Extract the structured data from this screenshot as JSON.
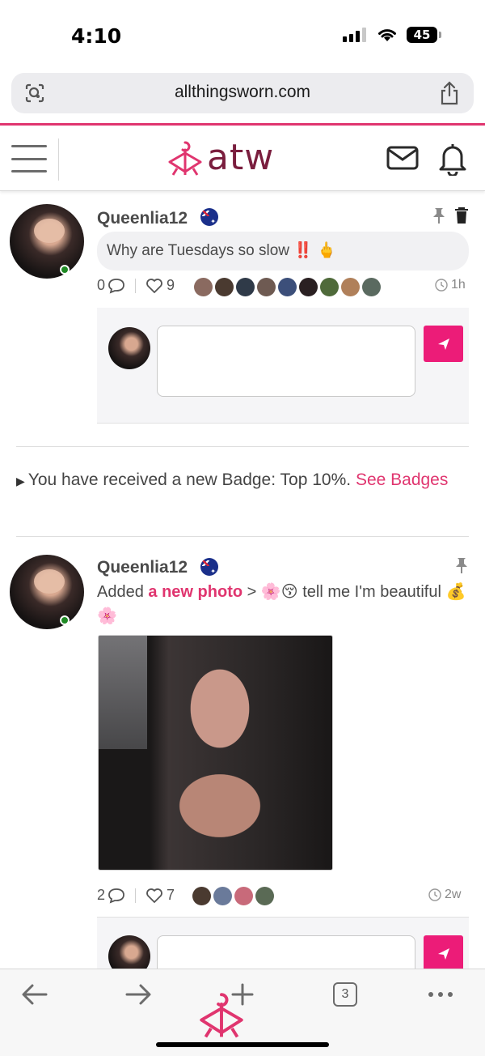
{
  "status_bar": {
    "time": "4:10",
    "battery": "45"
  },
  "browser": {
    "url": "allthingsworn.com",
    "tabs_count": "3"
  },
  "app": {
    "logo_text": "atw",
    "accent_color": "#e0356f",
    "brand_color": "#7a1e3e"
  },
  "post1": {
    "username": "Queenlia12",
    "message": "Why are Tuesdays so slow",
    "message_emoji": "‼️",
    "hand_emoji": "🖕",
    "comments": "0",
    "likes": "9",
    "time_ago": "1h"
  },
  "notification": {
    "text": "You have received a new Badge: Top 10%.",
    "link": "See Badges"
  },
  "post2": {
    "username": "Queenlia12",
    "prefix": "Added",
    "link": "a new photo",
    "arrow": ">",
    "caption_before": "🌸😚",
    "caption": "tell me I'm beautiful",
    "caption_after": "💰🌸",
    "comments": "2",
    "likes": "7",
    "time_ago": "2w"
  },
  "icons": [
    "lens-icon",
    "share-icon",
    "hamburger-icon",
    "mail-icon",
    "bell-icon",
    "pin-icon",
    "trash-icon",
    "comment-icon",
    "heart-icon",
    "clock-icon",
    "send-icon",
    "back-icon",
    "forward-icon",
    "plus-icon",
    "more-icon"
  ]
}
